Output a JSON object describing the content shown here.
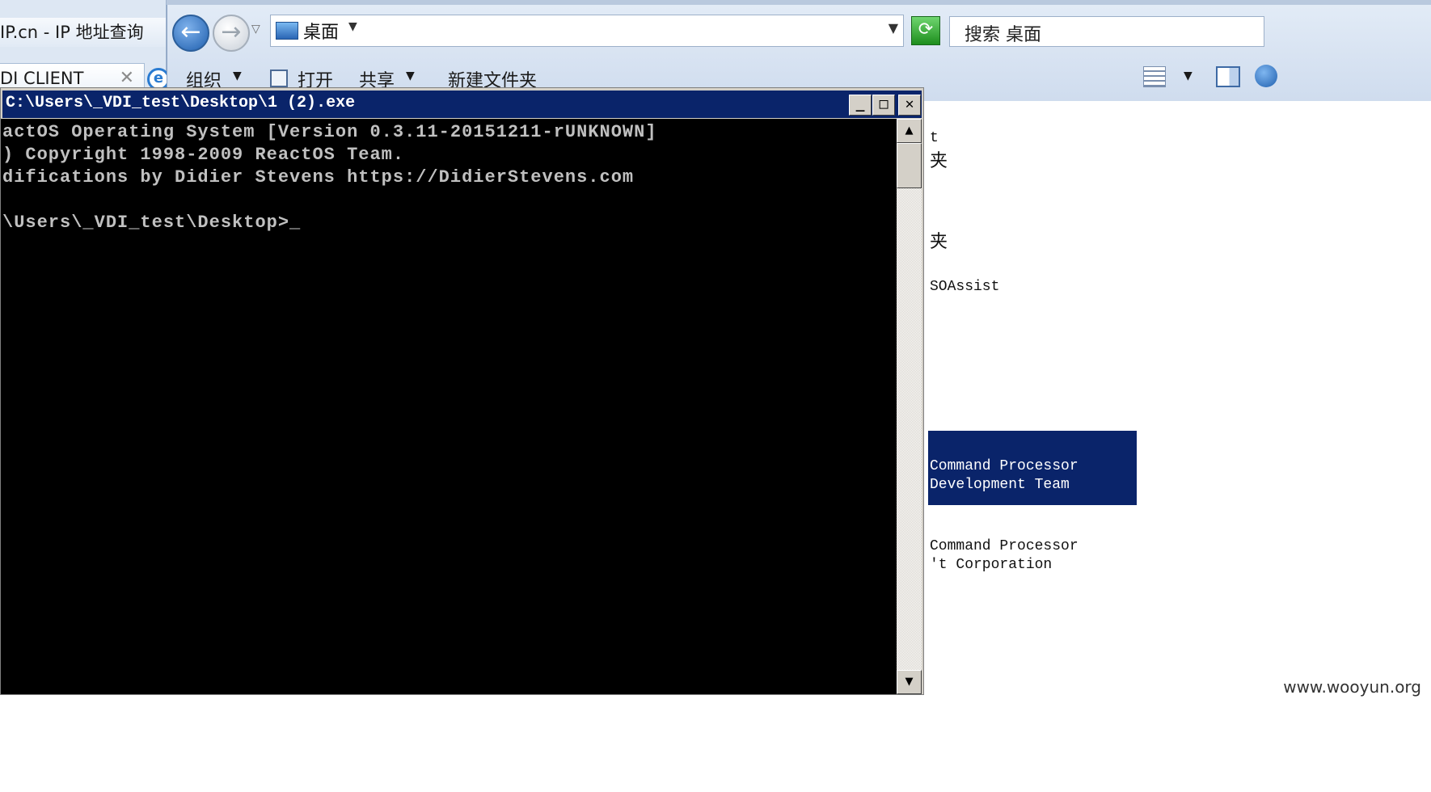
{
  "browser": {
    "tab1_title": "IP.cn - IP 地址查询 ",
    "tab2_title": "DI CLIENT",
    "tab2_close": "✕"
  },
  "explorer": {
    "address_text": "桌面",
    "search_placeholder": "搜索 桌面",
    "commands": {
      "organize": "组织",
      "open": "打开",
      "share": "共享",
      "new_folder": "新建文件夹"
    }
  },
  "file_pane": {
    "lines": {
      "l1": "t",
      "l2": "夹",
      "l3": "夹",
      "l4": "SOAssist",
      "sel1": "Command Processor",
      "sel2": "Development Team",
      "l5": "Command Processor",
      "l6": "'t Corporation"
    }
  },
  "console": {
    "title": "C:\\Users\\_VDI_test\\Desktop\\1 (2).exe",
    "buttons": {
      "minimize": "_",
      "maximize": "□",
      "close": "✕"
    },
    "lines": [
      "actOS Operating System [Version 0.3.11-20151211-rUNKNOWN]",
      ") Copyright 1998-2009 ReactOS Team.",
      "difications by Didier Stevens https://DidierStevens.com",
      "",
      "\\Users\\_VDI_test\\Desktop>_"
    ]
  },
  "watermark": "www.wooyun.org",
  "colors": {
    "title_bar": "#0a246a",
    "console_bg": "#000000",
    "console_text": "#c0c0c0",
    "selection": "#0a246a"
  }
}
